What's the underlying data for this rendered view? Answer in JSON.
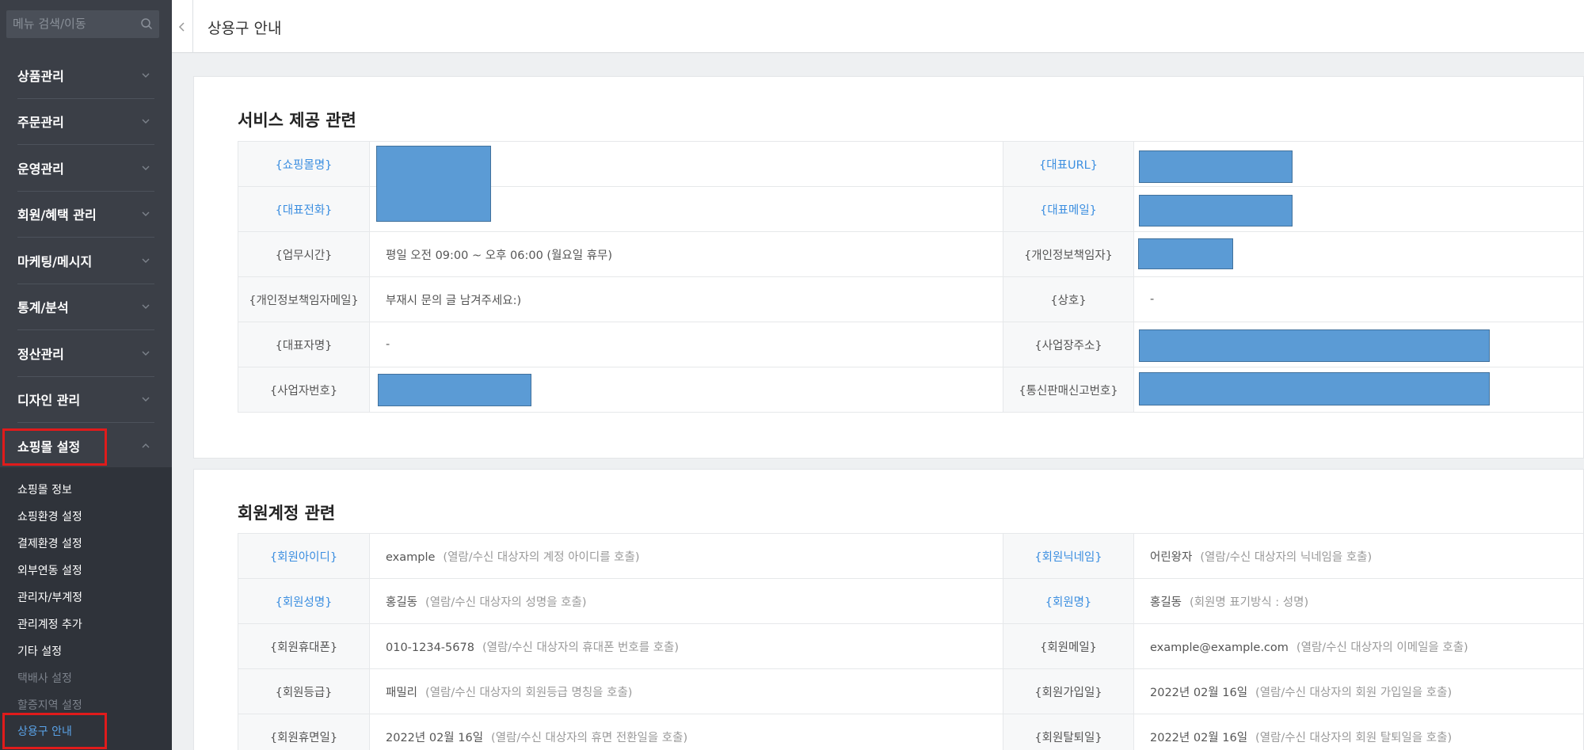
{
  "sidebar": {
    "search_placeholder": "메뉴 검색/이동",
    "menu": [
      {
        "label": "상품관리"
      },
      {
        "label": "주문관리"
      },
      {
        "label": "운영관리"
      },
      {
        "label": "회원/혜택 관리"
      },
      {
        "label": "마케팅/메시지"
      },
      {
        "label": "통계/분석"
      },
      {
        "label": "정산관리"
      },
      {
        "label": "디자인 관리"
      },
      {
        "label": "쇼핑몰 설정"
      }
    ],
    "submenu": [
      {
        "label": "쇼핑몰 정보"
      },
      {
        "label": "쇼핑환경 설정"
      },
      {
        "label": "결제환경 설정"
      },
      {
        "label": "외부연동 설정"
      },
      {
        "label": "관리자/부계정"
      },
      {
        "label": "관리계정 추가"
      },
      {
        "label": "기타 설정"
      },
      {
        "label": "택배사 설정"
      },
      {
        "label": "할증지역 설정"
      },
      {
        "label": "상용구 안내"
      }
    ]
  },
  "header": {
    "title": "상용구 안내"
  },
  "service": {
    "title": "서비스 제공 관련",
    "rows": [
      {
        "k1": "{쇼핑몰명}",
        "v1": "",
        "k2": "{대표URL}",
        "v2": ""
      },
      {
        "k1": "{대표전화}",
        "v1": "",
        "k2": "{대표메일}",
        "v2": ""
      },
      {
        "k1": "{업무시간}",
        "v1": "평일 오전 09:00 ~ 오후 06:00 (월요일 휴무)",
        "k2": "{개인정보책임자}",
        "v2": ""
      },
      {
        "k1": "{개인정보책임자메일}",
        "v1": "부재시 문의 글 남겨주세요:)",
        "k2": "{상호}",
        "v2": "-"
      },
      {
        "k1": "{대표자명}",
        "v1": "-",
        "k2": "{사업장주소}",
        "v2": ""
      },
      {
        "k1": "{사업자번호}",
        "v1": "",
        "k2": "{통신판매신고번호}",
        "v2": ""
      }
    ]
  },
  "member": {
    "title": "회원계정 관련",
    "rows": [
      {
        "k1": "{회원아이디}",
        "v1": "example",
        "d1": "(열람/수신 대상자의 계정 아이디를 호출)",
        "k2": "{회원닉네임}",
        "v2": "어린왕자",
        "d2": "(열람/수신 대상자의 닉네임을 호출)"
      },
      {
        "k1": "{회원성명}",
        "v1": "홍길동",
        "d1": "(열람/수신 대상자의 성명을 호출)",
        "k2": "{회원명}",
        "v2": "홍길동",
        "d2": "(회원명 표기방식 : 성명)"
      },
      {
        "k1": "{회원휴대폰}",
        "v1": "010-1234-5678",
        "d1": "(열람/수신 대상자의 휴대폰 번호를 호출)",
        "k2": "{회원메일}",
        "v2": "example@example.com",
        "d2": "(열람/수신 대상자의 이메일을 호출)"
      },
      {
        "k1": "{회원등급}",
        "v1": "패밀리",
        "d1": "(열람/수신 대상자의 회원등급 명칭을 호출)",
        "k2": "{회원가입일}",
        "v2": "2022년 02월 16일",
        "d2": "(열람/수신 대상자의 회원 가입일을 호출)"
      },
      {
        "k1": "{회원휴면일}",
        "v1": "2022년 02월 16일",
        "d1": "(열람/수신 대상자의 휴면 전환일을 호출)",
        "k2": "{회원탈퇴일}",
        "v2": "2022년 02월 16일",
        "d2": "(열람/수신 대상자의 회원 탈퇴일을 호출)"
      }
    ]
  },
  "colors": {
    "sidebar": "#3b3f47",
    "accent": "#3b8ee0",
    "highlight": "#e01b1b",
    "redaction": "#5b9bd5"
  },
  "icons": {
    "search": "search-icon",
    "chevron": "chevron-down-icon",
    "collapse": "chevron-left-icon"
  }
}
